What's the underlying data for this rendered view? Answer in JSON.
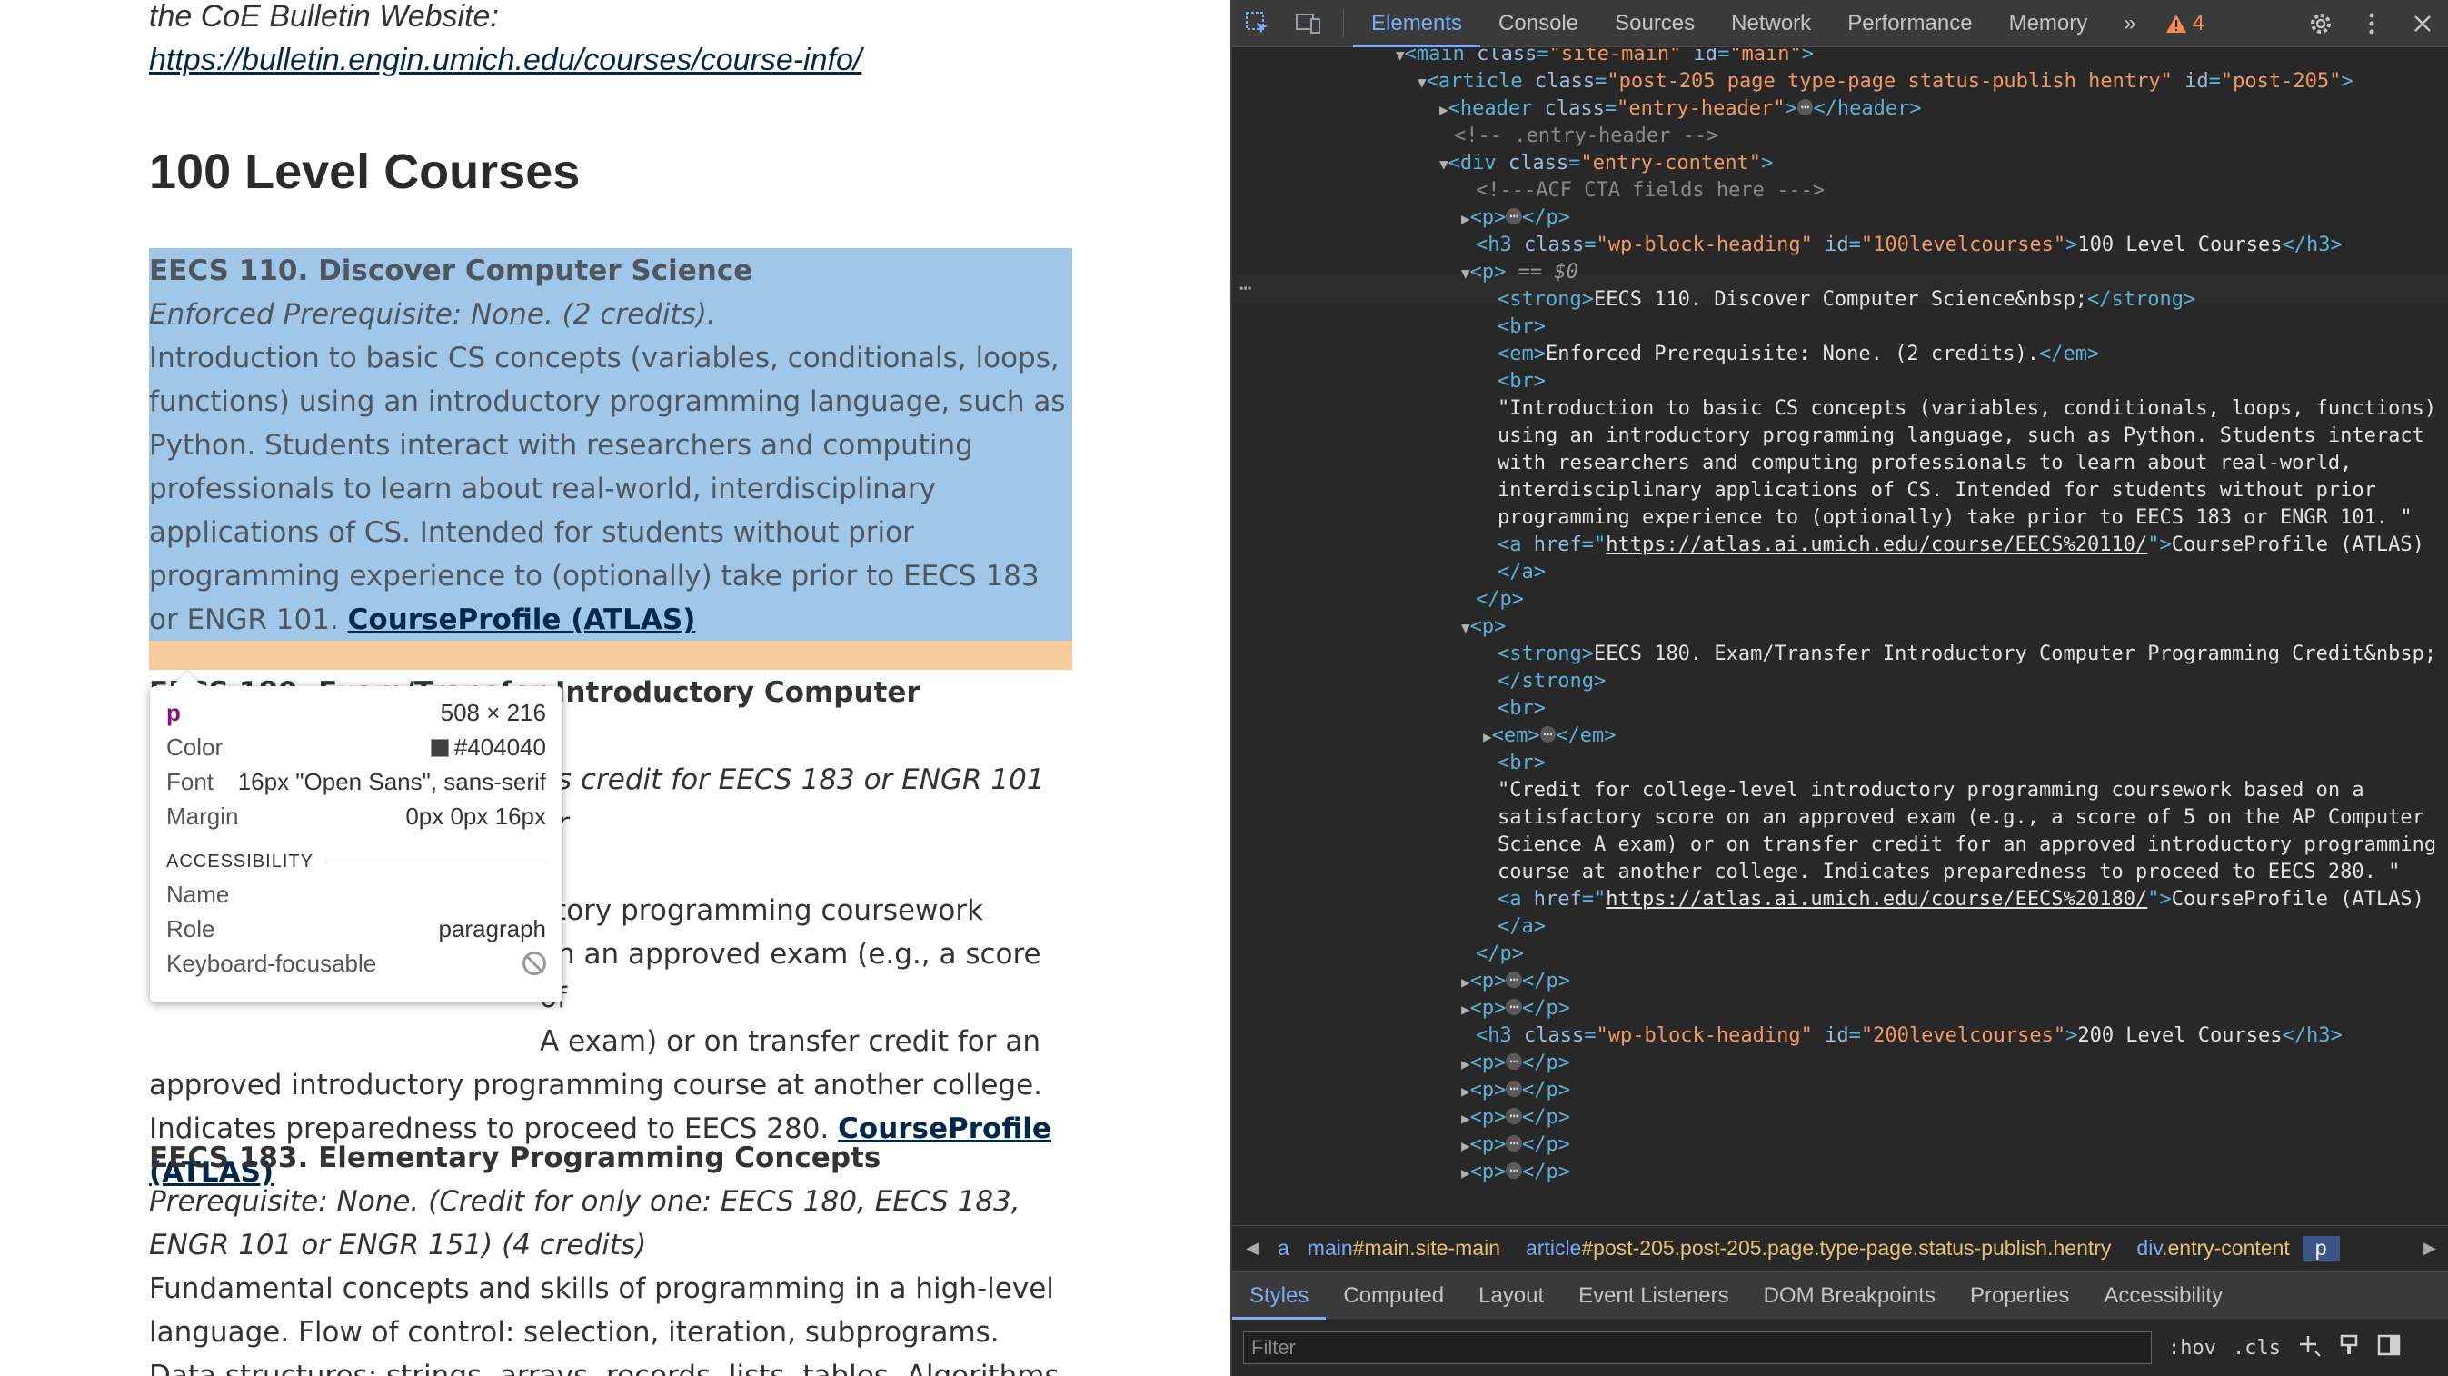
{
  "webpage": {
    "intro_text": "the CoE Bulletin Website: ",
    "intro_link": "https://bulletin.engin.umich.edu/courses/course-info/",
    "heading": "100 Level Courses",
    "courses": [
      {
        "title": "EECS 110. Discover Computer Science",
        "prereq": "Enforced Prerequisite: None. (2 credits).",
        "desc": "Introduction to basic CS concepts (variables, conditionals, loops, functions) using an introductory programming language, such as Python. Students interact with researchers and computing professionals to learn about real-world, interdisciplinary applications of CS. Intended for students without prior programming experience to (optionally) take prior to EECS 183 or ENGR 101. ",
        "link": "CourseProfile (ATLAS)"
      },
      {
        "title": "EECS 180. Exam/Transfer Introductory Computer Programming",
        "prereq_visible": "as credit for EECS 183 or ENGR 101 or",
        "desc_visible_1": "ctory programming coursework",
        "desc_visible_2": "on an approved exam (e.g., a score of",
        "desc_visible_3": "A exam) or on transfer credit for an",
        "desc_visible_4": "approved introductory programming course at another college.",
        "desc_visible_5": "Indicates preparedness to proceed to EECS 280. ",
        "link_1": "CourseProfile",
        "link_2": "(ATLAS)"
      },
      {
        "title": "EECS 183. Elementary Programming Concepts",
        "prereq": "Prerequisite: None. (Credit for only one: EECS 180, EECS 183, ENGR 101 or ENGR 151) (4 credits)",
        "desc": "Fundamental concepts and skills of programming in a high-level language. Flow of control: selection, iteration, subprograms. Data structures: strings, arrays, records, lists, tables. Algorithms using"
      }
    ]
  },
  "tooltip": {
    "tag": "p",
    "size": "508 × 216",
    "color_label": "Color",
    "color_value": "#404040",
    "font_label": "Font",
    "font_value": "16px \"Open Sans\", sans-serif",
    "margin_label": "Margin",
    "margin_value": "0px 0px 16px",
    "section": "ACCESSIBILITY",
    "name_label": "Name",
    "role_label": "Role",
    "role_value": "paragraph",
    "focus_label": "Keyboard-focusable"
  },
  "devtools": {
    "tabs": [
      "Elements",
      "Console",
      "Sources",
      "Network",
      "Performance",
      "Memory"
    ],
    "active_tab": "Elements",
    "warning_count": "4",
    "more_tabs": "»",
    "dom": {
      "l1_tag": "main",
      "l1_a1": "class",
      "l1_v1": "\"site-main\"",
      "l1_a2": "id",
      "l1_v2": "\"main\"",
      "l2_tag": "article",
      "l2_a1": "class",
      "l2_v1": "\"post-205 page type-page status-publish hentry\"",
      "l2_a2": "id",
      "l2_v2": "\"post-205\"",
      "l3_tag": "header",
      "l3_a1": "class",
      "l3_v1": "\"entry-header\"",
      "l3_close": "</header>",
      "l4_cmt": "<!-- .entry-header -->",
      "l5_tag": "div",
      "l5_a1": "class",
      "l5_v1": "\"entry-content\"",
      "l6_cmt": "<!---ACF CTA fields here --->",
      "h3_a1": "class",
      "h3_v1": "\"wp-block-heading\"",
      "h3_a2": "id",
      "h3_v2": "\"100levelcourses\"",
      "h3_text": "100 Level Courses",
      "sel_marker": "== $0",
      "p1_strong": "EECS 110. Discover Computer Science&nbsp;",
      "p1_em": "Enforced Prerequisite: None. (2 credits).",
      "p1_text": [
        "\"Introduction to basic CS concepts (variables, conditionals, loops, functions)",
        "using an introductory programming language, such as Python. Students interact",
        "with researchers and computing professionals to learn about real-world,",
        "interdisciplinary applications of CS. Intended for students without prior",
        "programming experience to (optionally) take prior to EECS 183 or ENGR 101. \""
      ],
      "p1_href": "https://atlas.ai.umich.edu/course/EECS%20110/",
      "p1_link": "CourseProfile (ATLAS)",
      "p2_strong": "EECS 180. Exam/Transfer Introductory Computer Programming Credit&nbsp;",
      "p2_text": [
        "\"Credit for college-level introductory programming coursework based on a",
        "satisfactory score on an approved exam (e.g., a score of 5 on the AP Computer",
        "Science A exam) or on transfer credit for an approved introductory programming",
        "course at another college. Indicates preparedness to proceed to EECS 280. \""
      ],
      "p2_href": "https://atlas.ai.umich.edu/course/EECS%20180/",
      "p2_link": "CourseProfile (ATLAS)",
      "h3b_v2": "\"200levelcourses\"",
      "h3b_text": "200 Level Courses"
    },
    "breadcrumb": {
      "item1": "a",
      "item2_tag": "main",
      "item2_cls": "#main.site-main",
      "item3_tag": "article",
      "item3_cls": "#post-205.post-205.page.type-page.status-publish.hentry",
      "item4_tag": "div",
      "item4_cls": ".entry-content",
      "item5": "p"
    },
    "styles_tabs": [
      "Styles",
      "Computed",
      "Layout",
      "Event Listeners",
      "DOM Breakpoints",
      "Properties",
      "Accessibility"
    ],
    "filter_placeholder": "Filter",
    "hov": ":hov",
    "cls": ".cls"
  }
}
